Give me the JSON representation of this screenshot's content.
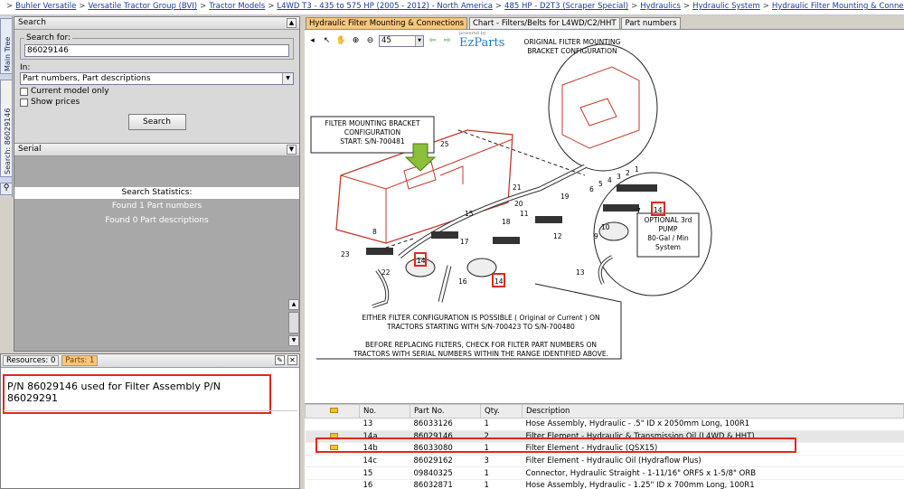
{
  "breadcrumb": [
    "Buhler Versatile",
    "Versatile Tractor Group (BVI)",
    "Tractor Models",
    "L4WD T3 - 435 to 575 HP (2005 - 2012) - North America",
    "485 HP - D2T3 (Scraper Special)",
    "Hydraulics",
    "Hydraulic System",
    "Hydraulic Filter Mounting & Connections"
  ],
  "vertical_tabs": [
    "Main Tree",
    "Search: 86029146"
  ],
  "search": {
    "panel_title": "Search",
    "legend": "Search for:",
    "query": "86029146",
    "in_label": "In:",
    "in_value": "Part numbers, Part descriptions",
    "current_model_label": "Current model only",
    "show_prices_label": "Show prices",
    "search_button": "Search"
  },
  "serial": {
    "title": "Serial"
  },
  "stats": {
    "title": "Search Statistics:",
    "part_numbers": "Found 1 Part numbers",
    "part_descriptions": "Found 0 Part descriptions"
  },
  "resources": {
    "tab_resources": "Resources: 0",
    "tab_parts": "Parts: 1",
    "message": "P/N 86029146 used for Filter Assembly P/N 86029291"
  },
  "tabs": [
    "Hydraulic Filter Mounting & Connections",
    "Chart - Filters/Belts for L4WD/C2/HHT",
    "Part numbers"
  ],
  "toolbar": {
    "zoom": "45",
    "brand": "EzParts",
    "brand_small": "powered by"
  },
  "diagram": {
    "label_original": "ORIGINAL  FILTER  MOUNTING",
    "label_original2": "BRACKET  CONFIGURATION",
    "label_filter": "FILTER  MOUNTING  BRACKET",
    "label_filter2": "CONFIGURATION",
    "label_filter3": "START:  S/N-700481",
    "label_optional": "OPTIONAL 3rd",
    "label_optional2": "PUMP",
    "label_optional3": "80-Gal / Min",
    "label_optional4": "System",
    "note1": "EITHER  FILTER  CONFIGURATION  IS  POSSIBLE  ( Original  or Current ) ON",
    "note2": "TRACTORS  STARTING  WITH  S/N-700423  TO  S/N-700480",
    "note3": "BEFORE  REPLACING  FILTERS,  CHECK  FOR  FILTER  PART NUMBERS  ON",
    "note4": "TRACTORS  WITH  SERIAL  NUMBERS  WITHIN  THE  RANGE  IDENTIFIED  ABOVE.",
    "callouts": [
      "1",
      "2",
      "3",
      "4",
      "5",
      "6",
      "7",
      "8",
      "9",
      "10",
      "11",
      "12",
      "13",
      "14",
      "15",
      "16",
      "17",
      "18",
      "19",
      "20",
      "21",
      "22",
      "23",
      "25"
    ],
    "highlight_callout": "14"
  },
  "parts": {
    "headers": [
      "No.",
      "Part No.",
      "Qty.",
      "Description"
    ],
    "rows": [
      {
        "no": "13",
        "part": "86033126",
        "qty": "1",
        "desc": "Hose Assembly, Hydraulic - .5\" ID x 2050mm Long, 100R1",
        "doc": false
      },
      {
        "no": "14a",
        "part": "86029146",
        "qty": "2",
        "desc": "Filter Element - Hydraulic & Transmission Oil (L4WD & HHT)",
        "doc": true
      },
      {
        "no": "14b",
        "part": "86033080",
        "qty": "1",
        "desc": "Filter Element - Hydraulic (QSX15)",
        "doc": true
      },
      {
        "no": "14c",
        "part": "86029162",
        "qty": "3",
        "desc": "Filter Element - Hydraulic Oil (Hydraflow Plus)",
        "doc": false
      },
      {
        "no": "15",
        "part": "09840325",
        "qty": "1",
        "desc": "Connector, Hydraulic Straight - 1-11/16\" ORFS x 1-5/8\" ORB",
        "doc": false
      },
      {
        "no": "16",
        "part": "86032871",
        "qty": "1",
        "desc": "Hose Assembly, Hydraulic - 1.25\" ID x 700mm Long, 100R1",
        "doc": false
      }
    ]
  }
}
